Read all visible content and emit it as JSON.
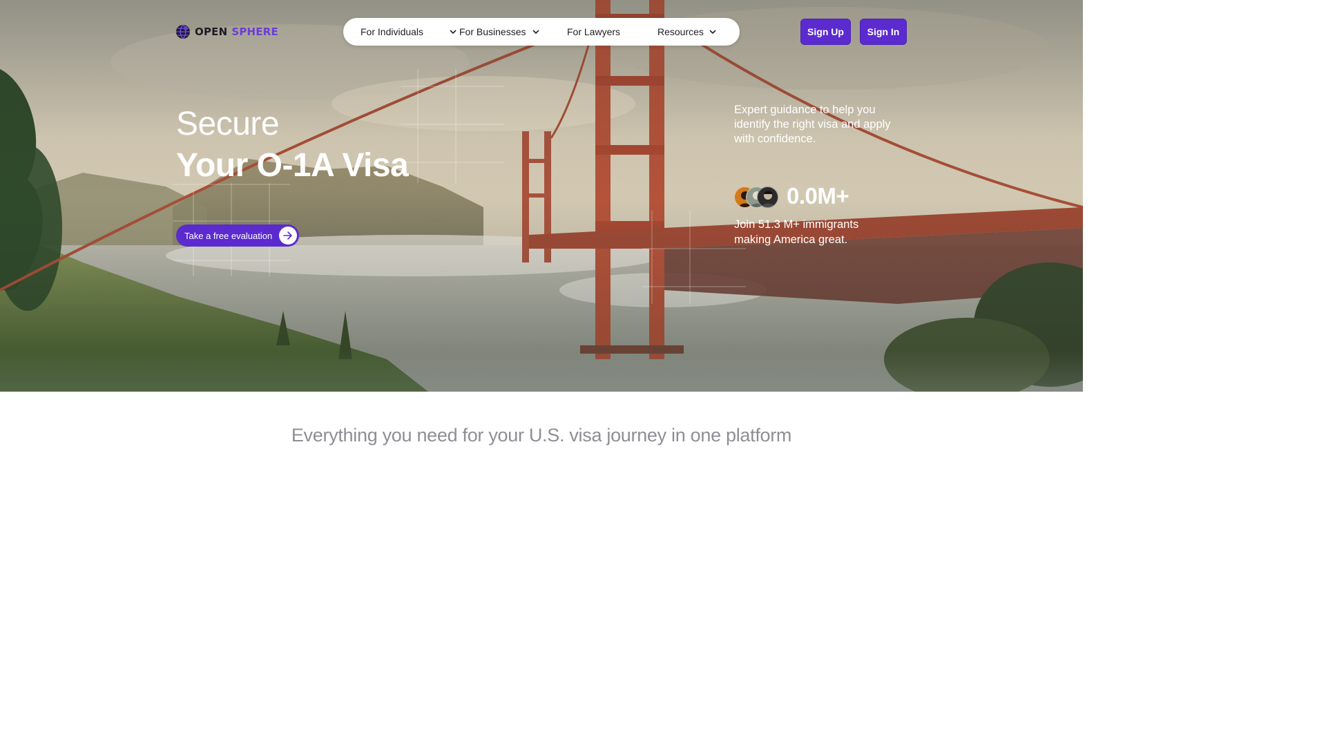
{
  "brand": {
    "name_part1": "OPEN",
    "name_part2": "SPHERE",
    "primary": "#5b2bd0",
    "icon": "globe-icon"
  },
  "nav": {
    "items": [
      {
        "label": "For Individuals",
        "has_dropdown": true
      },
      {
        "label": "For Businesses",
        "has_dropdown": true
      },
      {
        "label": "For Lawyers",
        "has_dropdown": false
      },
      {
        "label": "Resources",
        "has_dropdown": true
      }
    ],
    "sign_up_label": "Sign Up",
    "sign_in_label": "Sign In"
  },
  "hero": {
    "headline_line1": "Secure",
    "headline_line2": "Your O-1A Visa",
    "cta_label": "Take a free evaluation",
    "cta_icon": "arrow-right-icon",
    "tagline": "Expert guidance to help you identify the right visa and apply with confidence.",
    "stat_value": "0.0M+",
    "stat_text": "Join 51.3 M+ immigrants making America great.",
    "background": "golden-gate-bridge-painting"
  },
  "section": {
    "title": "Everything you need for your U.S. visa journey in one platform"
  }
}
